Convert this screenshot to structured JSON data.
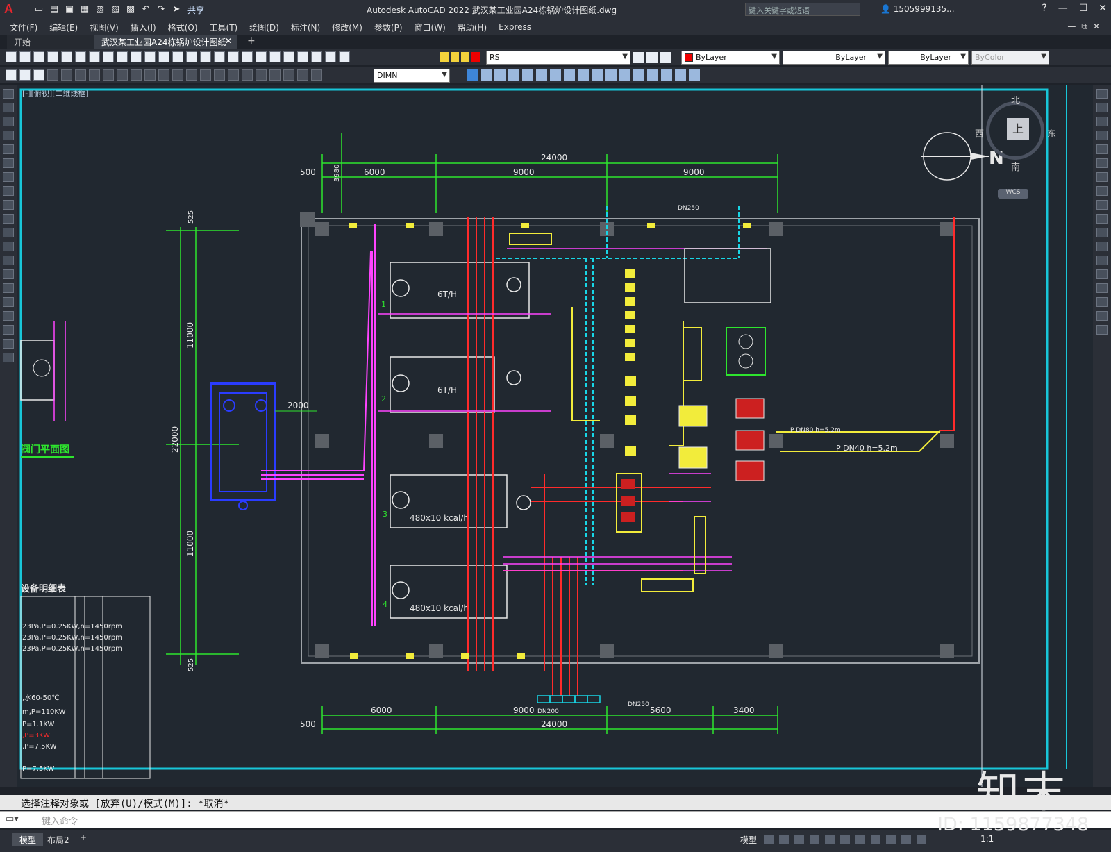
{
  "app": {
    "logo_letter": "A",
    "title": "Autodesk AutoCAD 2022    武汉某工业园A24栋锅炉设计图纸.dwg",
    "share_label": "共享",
    "search_placeholder": "键入关键字或短语",
    "user": "1505999135...",
    "help_icon": "?"
  },
  "menu": {
    "items": [
      "文件(F)",
      "编辑(E)",
      "视图(V)",
      "插入(I)",
      "格式(O)",
      "工具(T)",
      "绘图(D)",
      "标注(N)",
      "修改(M)",
      "参数(P)",
      "窗口(W)",
      "帮助(H)",
      "Express"
    ]
  },
  "tabs": {
    "start": "开始",
    "active": "武汉某工业园A24栋锅炉设计图纸*"
  },
  "toolbar": {
    "layer": "RS",
    "color": "ByLayer",
    "linetype": "ByLayer",
    "lineweight": "ByLayer",
    "plotstyle": "ByColor",
    "dimstyle": "DIMN"
  },
  "viewport": {
    "label": "[-][俯视][二维线框]",
    "compass": {
      "north": "北",
      "south": "南",
      "east": "东",
      "west": "西",
      "top": "上",
      "wcs": "WCS"
    }
  },
  "drawing": {
    "dims_top": {
      "total": "24000",
      "seg1": "6000",
      "seg2": "9000",
      "seg3": "9000",
      "left_off": "500",
      "v": "3980"
    },
    "dims_bottom": {
      "total": "24000",
      "seg1": "6000",
      "seg2": "9000",
      "seg3": "5600",
      "seg4": "3400",
      "left_off": "500"
    },
    "dims_left": {
      "total": "22000",
      "top": "11000",
      "bottom": "11000",
      "top_off": "525",
      "bottom_off": "525"
    },
    "dim_pool": "2000",
    "north_label": "N",
    "boilers": [
      {
        "name": "1",
        "cap": "6T/H"
      },
      {
        "name": "2",
        "cap": "6T/H"
      },
      {
        "name": "3",
        "cap": "480x10 kcal/h"
      },
      {
        "name": "4",
        "cap": "480x10 kcal/h"
      }
    ],
    "labels": {
      "valve_plan": "阀门平面图",
      "equipment_table": "设备明细表",
      "p_dn80": "P DN80 h=5.2m",
      "p_dn40": "P DN40 h=5.2m",
      "dn250_top": "DN250",
      "dn250_bottom": "DN250",
      "dn200_bottom": "DN200"
    },
    "table_rows": [
      "23Pa,P=0.25KW,n=1450rpm",
      "23Pa,P=0.25KW,n=1450rpm",
      "23Pa,P=0.25KW,n=1450rpm",
      ",水60-50℃",
      "m,P=110KW",
      "P=1.1KW",
      ",P=3KW",
      ",P=7.5KW",
      "P=7.5KW"
    ]
  },
  "command": {
    "history": "选择注释对象或 [放弃(U)/模式(M)]: *取消*",
    "placeholder": "键入命令"
  },
  "status": {
    "model_tab": "模型",
    "layout_tab": "布局2",
    "add_tab": "+",
    "mode": "模型",
    "scale": "1:1"
  },
  "watermark": {
    "logo": "知末",
    "id": "ID: 1159877348"
  }
}
